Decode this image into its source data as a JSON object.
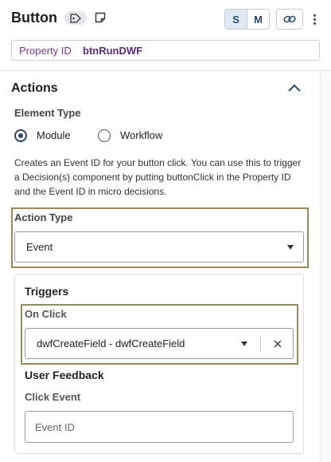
{
  "header": {
    "title": "Button",
    "size_options": [
      "S",
      "M"
    ],
    "active_size": "S"
  },
  "property": {
    "label": "Property ID",
    "value": "btnRunDWF"
  },
  "actions": {
    "title": "Actions",
    "element_type_label": "Element Type",
    "element_type_options": [
      "Module",
      "Workflow"
    ],
    "element_type_selected": "Module",
    "description": "Creates an Event ID for your button click. You can use this to trigger a Decision(s) component by putting buttonClick in the Property ID and the Event ID in micro decisions.",
    "action_type_label": "Action Type",
    "action_type_value": "Event"
  },
  "triggers": {
    "title": "Triggers",
    "on_click_label": "On Click",
    "on_click_value": "dwfCreateField - dwfCreateField",
    "user_feedback_label": "User Feedback",
    "click_event_label": "Click Event",
    "click_event_placeholder": "Event ID"
  },
  "colors": {
    "accent": "#2b4a6b",
    "highlight_border": "#948a5a",
    "property_label": "#7a3a8f"
  }
}
